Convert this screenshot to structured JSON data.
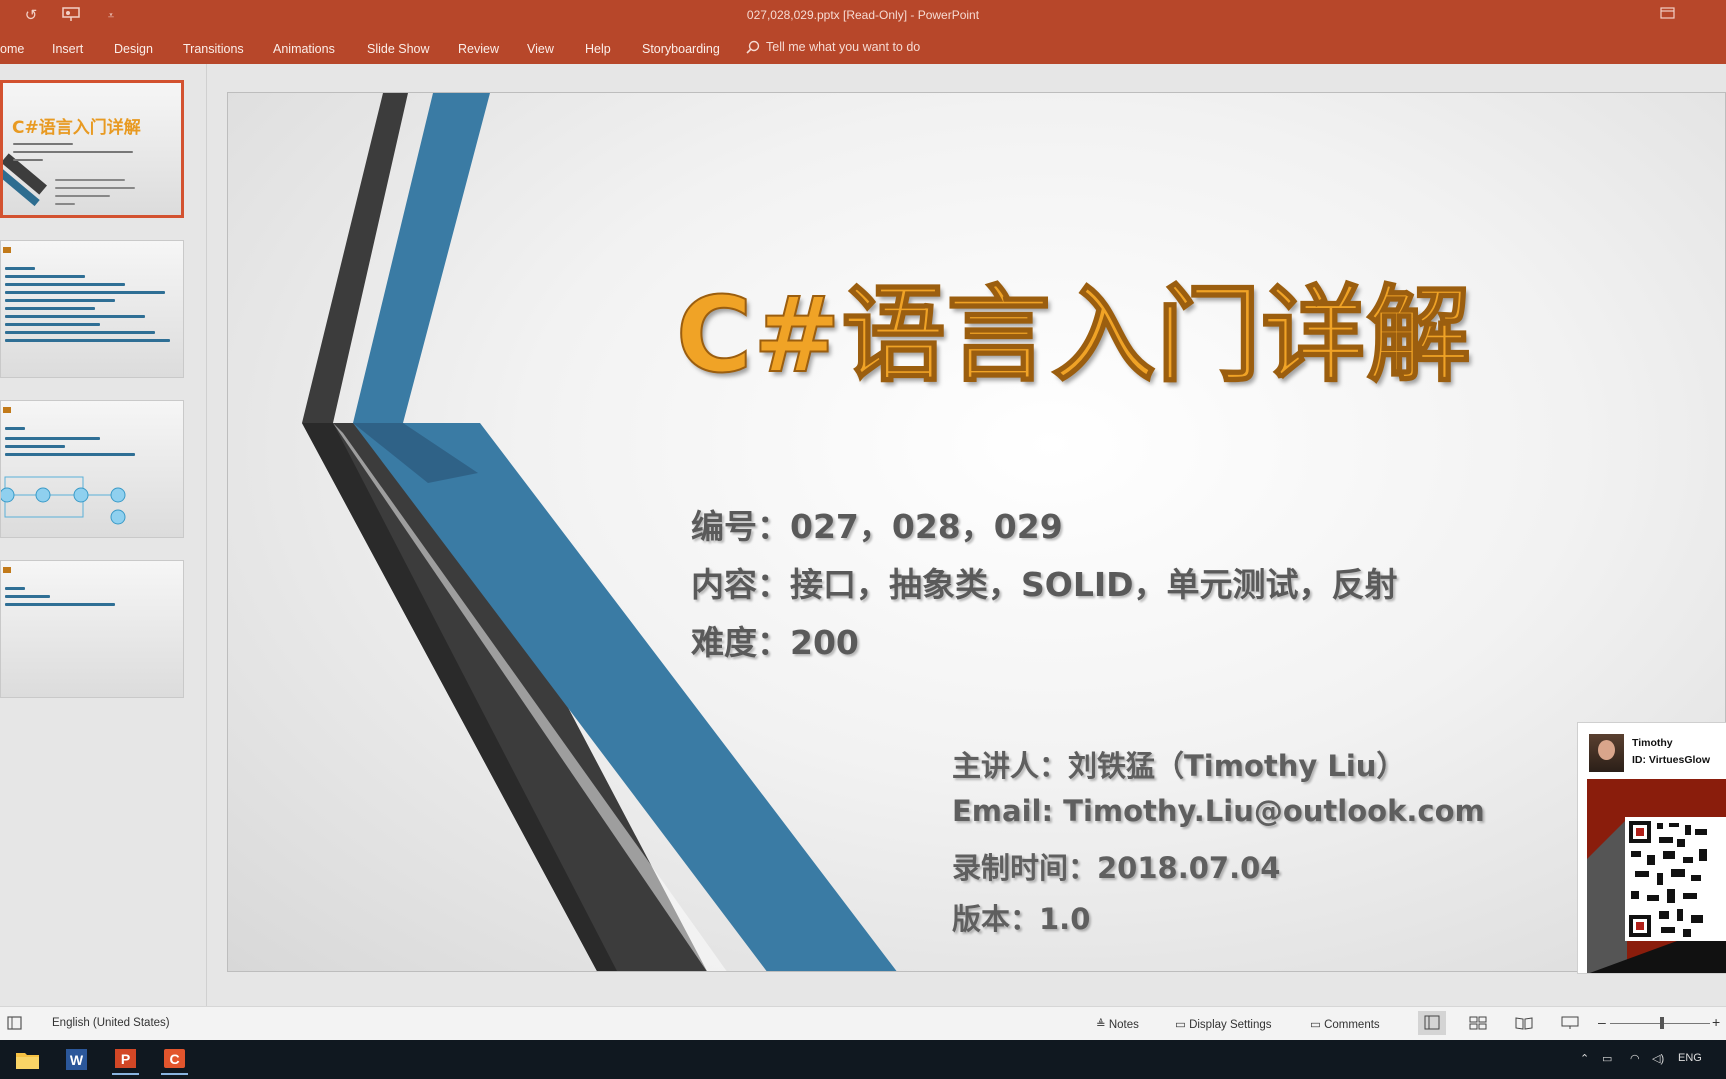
{
  "app": {
    "window_title": "027,028,029.pptx [Read-Only]  -  PowerPoint",
    "accent_color": "#b7472a"
  },
  "ribbon": {
    "tabs": [
      "ome",
      "Insert",
      "Design",
      "Transitions",
      "Animations",
      "Slide Show",
      "Review",
      "View",
      "Help",
      "Storyboarding"
    ],
    "tell_me": "Tell me what you want to do"
  },
  "quick_access": {
    "icons": [
      "redo-icon",
      "present-from-start-icon",
      "customize-quick-access-icon"
    ]
  },
  "thumbnails": {
    "selected_index": 0,
    "first_title": "C#语言入门详解"
  },
  "slide": {
    "title": "C#语言入门详解",
    "info": [
      "编号：027，028，029",
      "内容：接口，抽象类，SOLID，单元测试，反射",
      "难度：200"
    ],
    "speaker": [
      "主讲人：刘铁猛（Timothy Liu）",
      "Email: Timothy.Liu@outlook.com",
      "录制时间：2018.07.04",
      "版本：1.0"
    ]
  },
  "overlay": {
    "name": "Timothy",
    "id_line": "ID: VirtuesGlow"
  },
  "statusbar": {
    "language": "English (United States)",
    "notes": "Notes",
    "display_settings": "Display Settings",
    "comments": "Comments"
  },
  "taskbar": {
    "apps": [
      "file-explorer-icon",
      "word-icon",
      "powerpoint-icon",
      "camtasia-icon"
    ],
    "input_language": "ENG"
  }
}
